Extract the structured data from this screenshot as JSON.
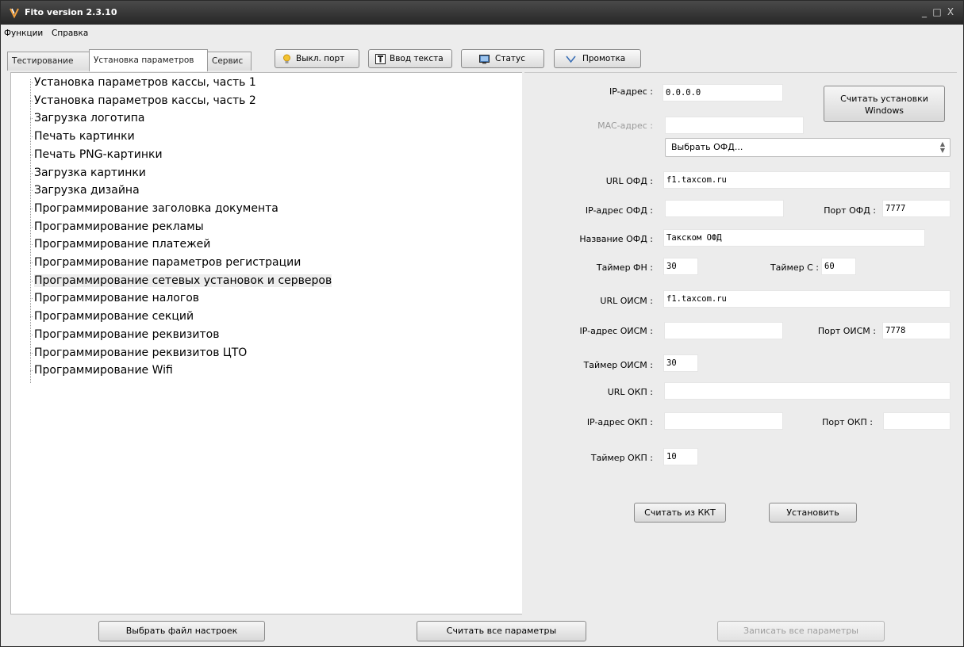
{
  "window": {
    "title": "Fito version 2.3.10",
    "controls": [
      "_",
      "□",
      "X"
    ]
  },
  "menu": [
    "Функции",
    "Справка"
  ],
  "tabs": [
    {
      "label": "Тестирование",
      "active": false
    },
    {
      "label": "Установка параметров",
      "active": true
    },
    {
      "label": "Сервис",
      "active": false
    }
  ],
  "toolbar": {
    "port_off": {
      "label": "Выкл. порт",
      "icon": "lightbulb-icon"
    },
    "text_input": {
      "label": "Ввод текста",
      "icon": "text-t-icon"
    },
    "status": {
      "label": "Статус",
      "icon": "monitor-icon"
    },
    "feed": {
      "label": "Промотка",
      "icon": "chevron-down-icon"
    }
  },
  "tree": {
    "items": [
      "Установка параметров кассы, часть 1",
      "Установка параметров кассы, часть 2",
      "Загрузка логотипа",
      "Печать картинки",
      "Печать PNG-картинки",
      "Загрузка картинки",
      "Загрузка дизайна",
      "Программирование заголовка документа",
      "Программирование рекламы",
      "Программирование платежей",
      "Программирование параметров регистрации",
      "Программирование сетевых установок и серверов",
      "Программирование налогов",
      "Программирование секций",
      "Программирование реквизитов",
      "Программирование реквизитов ЦТО",
      "Программирование Wifi"
    ],
    "selected_index": 11
  },
  "form": {
    "ip_label": "IP-адрес :",
    "ip_value": "0.0.0.0",
    "read_windows_label": "Считать установки Windows",
    "mac_label": "MAC-адрес :",
    "mac_value": "",
    "ofd_select": "Выбрать ОФД...",
    "url_ofd_label": "URL ОФД :",
    "url_ofd_value": "f1.taxcom.ru",
    "ip_ofd_label": "IP-адрес ОФД :",
    "ip_ofd_value": "",
    "port_ofd_label": "Порт ОФД :",
    "port_ofd_value": "7777",
    "name_ofd_label": "Название ОФД :",
    "name_ofd_value": "Такском ОФД",
    "timer_fn_label": "Таймер ФН :",
    "timer_fn_value": "30",
    "timer_c_label": "Таймер С :",
    "timer_c_value": "60",
    "url_oism_label": "URL ОИСМ :",
    "url_oism_value": "f1.taxcom.ru",
    "ip_oism_label": "IP-адрес ОИСМ :",
    "ip_oism_value": "",
    "port_oism_label": "Порт ОИСМ :",
    "port_oism_value": "7778",
    "timer_oism_label": "Таймер ОИСМ :",
    "timer_oism_value": "30",
    "url_okp_label": "URL ОКП :",
    "url_okp_value": "",
    "ip_okp_label": "IP-адрес ОКП :",
    "ip_okp_value": "",
    "port_okp_label": "Порт ОКП :",
    "port_okp_value": "",
    "timer_okp_label": "Таймер ОКП :",
    "timer_okp_value": "10",
    "read_kkt_label": "Считать из ККТ",
    "set_label": "Установить"
  },
  "bottom": {
    "choose_file": "Выбрать файл настроек",
    "read_all": "Считать все параметры",
    "write_all": "Записать все параметры"
  }
}
